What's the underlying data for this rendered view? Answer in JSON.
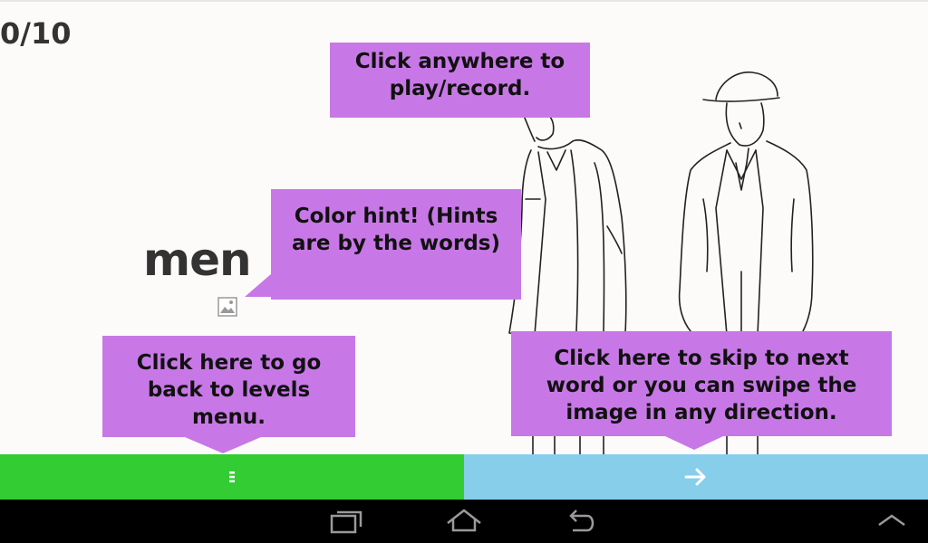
{
  "header": {
    "score": "0/10"
  },
  "word": {
    "text": "men"
  },
  "tips": {
    "play_record": "Click anywhere to play/record.",
    "color_hint": "Color hint! (Hints are by the words)",
    "back_levels": "Click here to go back to levels menu.",
    "skip_next": "Click here to skip to next word or you can swipe the image in any direction."
  },
  "icons": {
    "image_hint": "image-icon",
    "menu_button": "menu-icon",
    "next_button": "arrow-right-icon",
    "nav_recent": "recent-apps-icon",
    "nav_home": "home-icon",
    "nav_back": "back-icon",
    "nav_menu": "chevron-up-icon"
  },
  "colors": {
    "tip_background": "#c878e6",
    "menu_button": "#33cc33",
    "next_button": "#87ceeb",
    "navbar": "#000000"
  }
}
